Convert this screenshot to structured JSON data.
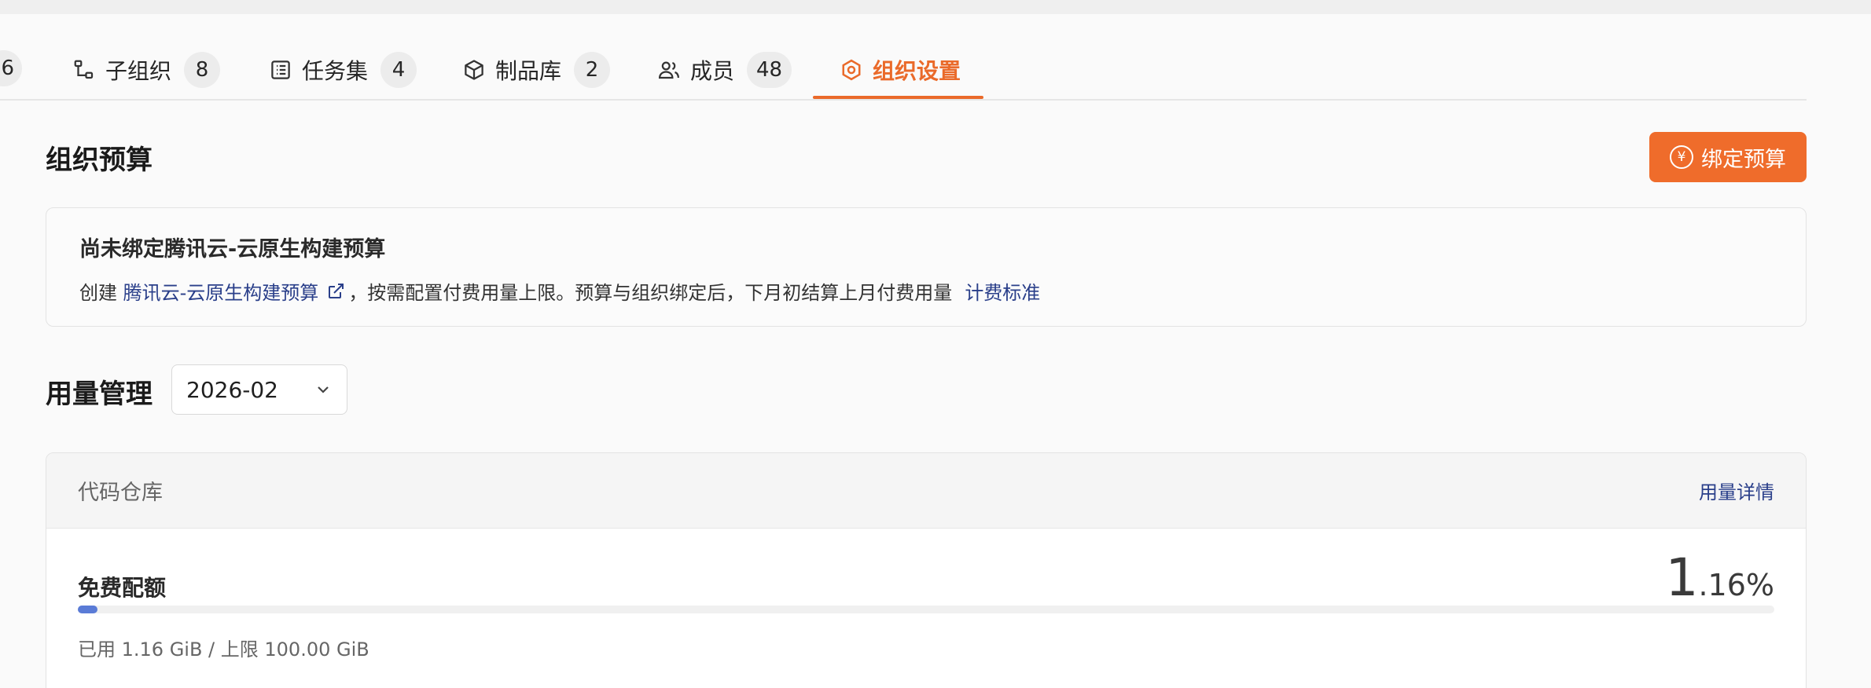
{
  "tabs": {
    "partial_badge": "6",
    "items": [
      {
        "label": "子组织",
        "count": "8"
      },
      {
        "label": "任务集",
        "count": "4"
      },
      {
        "label": "制品库",
        "count": "2"
      },
      {
        "label": "成员",
        "count": "48"
      },
      {
        "label": "组织设置"
      }
    ],
    "active": "组织设置"
  },
  "budget": {
    "title": "组织预算",
    "bind_button": "绑定预算",
    "notice_title": "尚未绑定腾讯云-云原生构建预算",
    "line_prefix": "创建 ",
    "link_text": "腾讯云-云原生构建预算",
    "line_middle": "，按需配置付费用量上限。预算与组织绑定后，下月初结算上月付费用量",
    "billing_link": "计费标准"
  },
  "usage": {
    "title": "用量管理",
    "month": "2026-02",
    "card": {
      "title": "代码仓库",
      "detail_link": "用量详情",
      "quota_title": "免费配额",
      "percent_int": "1",
      "percent_frac": ".16%",
      "progress": 0.0116,
      "used_text": "已用 1.16 GiB / 上限 100.00 GiB"
    }
  },
  "colors": {
    "accent": "#ea6a2a",
    "link": "#2a3f8a",
    "progress": "#5a7bd6"
  }
}
